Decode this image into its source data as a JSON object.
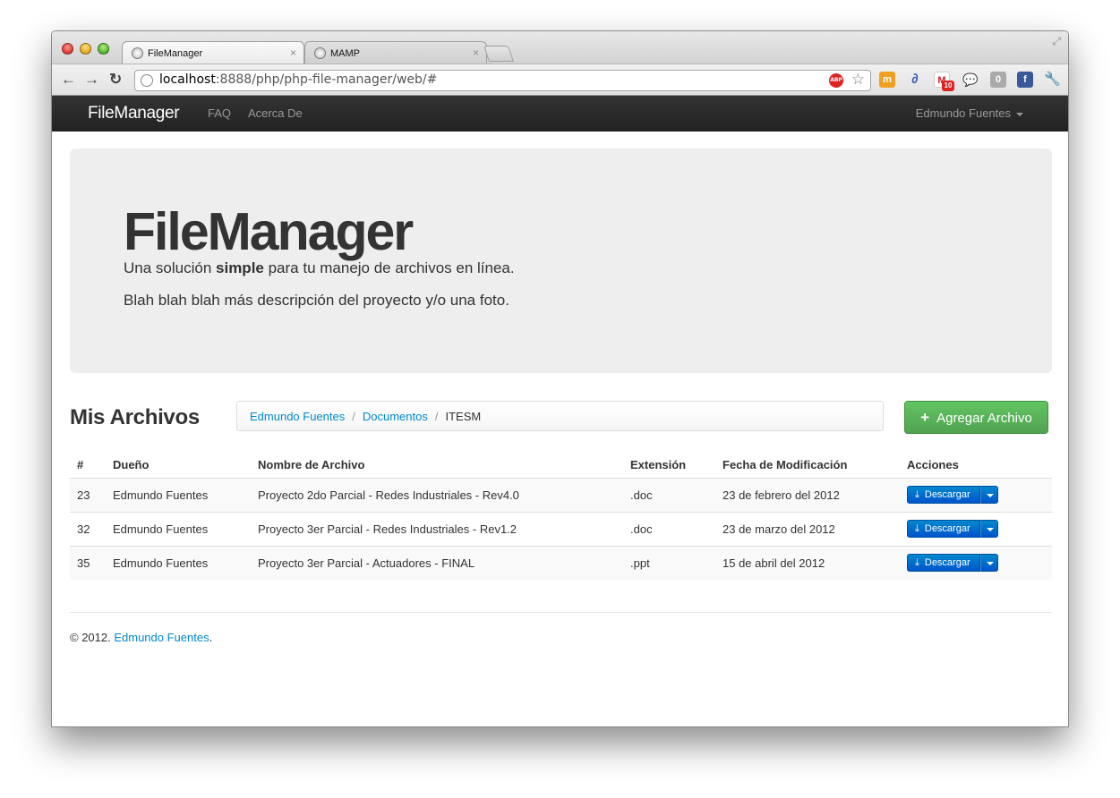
{
  "browser": {
    "tabs": [
      {
        "label": "FileManager",
        "close": "×",
        "active": true
      },
      {
        "label": "MAMP",
        "close": "×",
        "active": false
      }
    ],
    "url": {
      "host": "localhost",
      "rest": ":8888/php/php-file-manager/web/#"
    },
    "abp_label": "ABP",
    "extension_badges": {
      "gmail_count": "10",
      "counter": "0"
    }
  },
  "navbar": {
    "brand": "FileManager",
    "links": [
      "FAQ",
      "Acerca De"
    ],
    "user": "Edmundo Fuentes"
  },
  "hero": {
    "title": "FileManager",
    "lead_before": "Una solución ",
    "lead_bold": "simple",
    "lead_after": " para tu manejo de archivos en línea.",
    "description": "Blah blah blah más descripción del proyecto y/o una foto."
  },
  "files_section": {
    "title": "Mis Archivos",
    "breadcrumb": [
      "Edmundo Fuentes",
      "Documentos",
      "ITESM"
    ],
    "add_button": "Agregar Archivo",
    "columns": [
      "#",
      "Dueño",
      "Nombre de Archivo",
      "Extensión",
      "Fecha de Modificación",
      "Acciones"
    ],
    "rows": [
      {
        "id": "23",
        "owner": "Edmundo Fuentes",
        "name": "Proyecto 2do Parcial - Redes Industriales - Rev4.0",
        "ext": ".doc",
        "date": "23 de febrero del 2012",
        "action": "Descargar"
      },
      {
        "id": "32",
        "owner": "Edmundo Fuentes",
        "name": "Proyecto 3er Parcial - Redes Industriales - Rev1.2",
        "ext": ".doc",
        "date": "23 de marzo del 2012",
        "action": "Descargar"
      },
      {
        "id": "35",
        "owner": "Edmundo Fuentes",
        "name": "Proyecto 3er Parcial - Actuadores - FINAL",
        "ext": ".ppt",
        "date": "15 de abril del 2012",
        "action": "Descargar"
      }
    ]
  },
  "footer": {
    "prefix": "© 2012. ",
    "link": "Edmundo Fuentes",
    "suffix": "."
  }
}
